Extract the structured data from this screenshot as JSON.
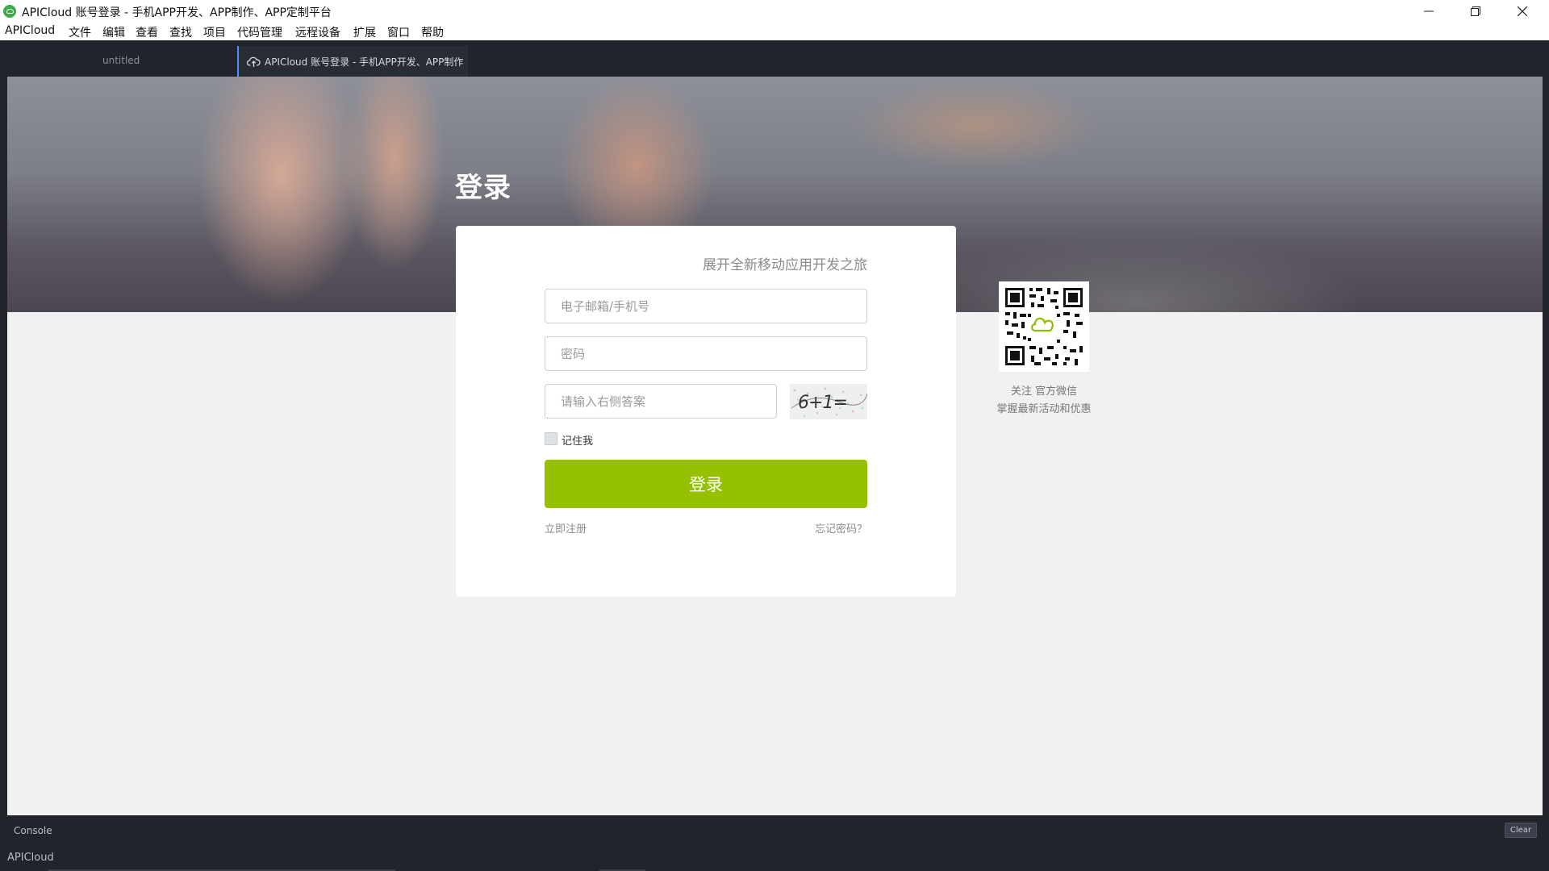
{
  "window": {
    "title": "APICloud 账号登录 - 手机APP开发、APP制作、APP定制平台"
  },
  "menu": [
    "APICloud",
    "文件",
    "编辑",
    "查看",
    "查找",
    "项目",
    "代码管理",
    "远程设备",
    "扩展",
    "窗口",
    "帮助"
  ],
  "tabs": [
    {
      "label": "untitled",
      "active": false
    },
    {
      "label": "APICloud 账号登录 - 手机APP开发、APP制作、APP定制平台",
      "active": true,
      "icon": "cloud-upload-icon"
    }
  ],
  "page": {
    "heading": "登录",
    "slogan": "展开全新移动应用开发之旅",
    "account_placeholder": "电子邮箱/手机号",
    "password_placeholder": "密码",
    "captcha_placeholder": "请输入右侧答案",
    "captcha_text": "6+1=",
    "remember_label": "记住我",
    "login_button": "登录",
    "register_link": "立即注册",
    "forgot_link": "忘记密码？",
    "qr_line1": "关注 官方微信",
    "qr_line2": "掌握最新活动和优惠"
  },
  "console": {
    "label": "Console",
    "clear_button": "Clear"
  },
  "status": {
    "label": "APICloud"
  },
  "colors": {
    "accent_green": "#95c101",
    "tab_indicator": "#528bff",
    "dark_chrome": "#21252b"
  }
}
